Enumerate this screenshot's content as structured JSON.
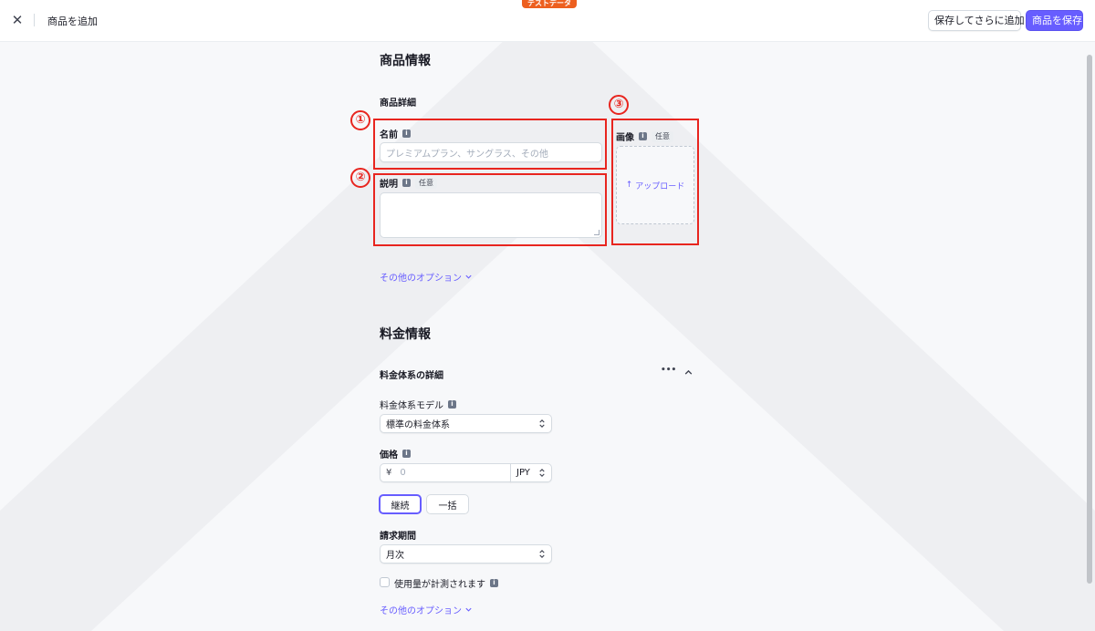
{
  "topbar": {
    "close_glyph": "✕",
    "title": "商品を追加",
    "test_badge": "テストデータ",
    "save_and_add_label": "保存してさらに追加",
    "save_label": "商品を保存"
  },
  "product_info": {
    "heading": "商品情報",
    "subheading": "商品詳細",
    "annotation_1": "①",
    "annotation_2": "②",
    "annotation_3": "③",
    "name_label": "名前",
    "name_placeholder": "プレミアムプラン、サングラス、その他",
    "description_label": "説明",
    "optional_badge": "任意",
    "image_label": "画像",
    "image_optional_badge": "任意",
    "upload_label": "アップロード",
    "more_options": "その他のオプション"
  },
  "pricing": {
    "heading": "料金情報",
    "subheading": "料金体系の詳細",
    "more_glyph": "•••",
    "model_label": "料金体系モデル",
    "model_value": "標準の料金体系",
    "price_label": "価格",
    "currency_symbol": "¥",
    "price_placeholder": "0",
    "currency": "JPY",
    "segment_recurring": "継続",
    "segment_one_time": "一括",
    "billing_period_label": "請求期間",
    "billing_period_value": "月次",
    "metered_label": "使用量が計測されます",
    "more_options": "その他のオプション"
  },
  "icons": {
    "info": "i",
    "chevron_down": "⌄",
    "chevron_up_glyph": "︿",
    "select_arrows": "⌃⌄",
    "upload_arrow": "↑"
  },
  "colors": {
    "accent": "#675dff",
    "annotation_red": "#e8251f",
    "test_badge": "#ed5f1f"
  }
}
